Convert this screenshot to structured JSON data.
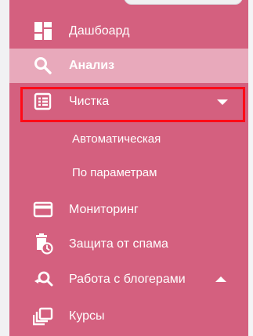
{
  "sidebar": {
    "items": [
      {
        "label": "Дашбоард",
        "icon": "dashboard-icon",
        "active": false
      },
      {
        "label": "Анализ",
        "icon": "search-icon",
        "active": true
      },
      {
        "label": "Чистка",
        "icon": "list-icon",
        "active": false,
        "expanded": true,
        "children": [
          {
            "label": "Автоматическая"
          },
          {
            "label": "По параметрам"
          }
        ]
      },
      {
        "label": "Мониторинг",
        "icon": "card-icon",
        "active": false
      },
      {
        "label": "Защита от спама",
        "icon": "trash-clock-icon",
        "active": false
      },
      {
        "label": "Работа с блогерами",
        "icon": "search-back-icon",
        "active": false,
        "expanded": false
      },
      {
        "label": "Курсы",
        "icon": "collection-icon",
        "active": false
      }
    ]
  },
  "colors": {
    "sidebar_bg": "#d4607f",
    "active_bg": "#e8a9bb",
    "highlight": "#ff0a17",
    "text": "#ffffff"
  }
}
